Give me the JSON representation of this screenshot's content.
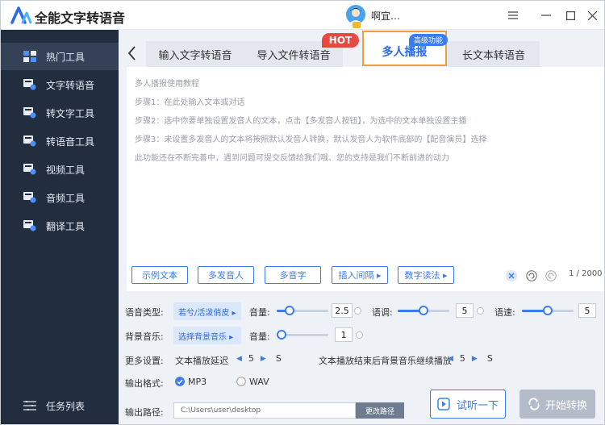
{
  "app": {
    "title": "全能文字转语音",
    "username": "啊宜…"
  },
  "sidebar": {
    "items": [
      {
        "label": "热门工具",
        "active": true
      },
      {
        "label": "文字转语音"
      },
      {
        "label": "转文字工具"
      },
      {
        "label": "转语音工具"
      },
      {
        "label": "视频工具"
      },
      {
        "label": "音频工具"
      },
      {
        "label": "翻译工具"
      }
    ],
    "tasks": "任务列表"
  },
  "tabs": [
    {
      "label": "输入文字转语音"
    },
    {
      "label": "导入文件转语音"
    },
    {
      "label": "多人播报",
      "active": true
    },
    {
      "label": "长文本转语音"
    }
  ],
  "badges": {
    "hot": "HOT",
    "pro": "高级功能"
  },
  "editor": {
    "placeholder_lines": [
      "多人播报使用教程",
      "步骤1：在此处输入文本或对话",
      "步骤2：选中你要单独设置发音人的文本，点击【多发音人按钮】，为选中的文本单独设置主播",
      "步骤3：未设置多发音人的文本将按照默认发音人转换，默认发音人为软件底部的【配音演员】选择",
      "此功能还在不断完善中，遇到问题可提交反馈给我们哦、您的支持是我们不断前进的动力"
    ]
  },
  "toolbar": {
    "buttons": [
      {
        "label": "示例文本"
      },
      {
        "label": "多发音人"
      },
      {
        "label": "多音字"
      },
      {
        "label": "插入间隔 ▸"
      },
      {
        "label": "数字读法 ▸"
      }
    ],
    "char_count": "1 / 2000"
  },
  "settings": {
    "voice_type_label": "语音类型:",
    "voice_value": "若兮/活泼俏皮 ▸",
    "volume_label": "音量:",
    "volume_value": "2.5",
    "volume_fraction": 0.25,
    "pitch_label": "语调:",
    "pitch_value": "5",
    "pitch_fraction": 0.5,
    "speed_label": "语速:",
    "speed_value": "5",
    "speed_fraction": 0.5,
    "bgm_label": "背景音乐:",
    "bgm_value": "选择背景音乐 ▸",
    "bgm_volume_label": "音量:",
    "bgm_volume_value": "1",
    "bgm_volume_fraction": 0.1,
    "more_label": "更多设置:",
    "delay_label": "文本播放延迟",
    "delay_value": "5",
    "delay_unit": "S",
    "bgm_continue_label": "文本播放结束后背景音乐继续播放",
    "bgm_continue_value": "5",
    "bgm_continue_unit": "S",
    "format_label": "输出格式:",
    "format_mp3": "MP3",
    "format_wav": "WAV",
    "format_selected": "MP3",
    "path_label": "输出路径:",
    "path_value": "C:\\Users\\user\\desktop",
    "change_path": "更改路径"
  },
  "actions": {
    "listen": "试听一下",
    "convert": "开始转换"
  },
  "colors": {
    "accent": "#3b7df1",
    "sidebar": "#222d3e",
    "hot": "#e5493f",
    "highlight": "#f39c3c"
  }
}
